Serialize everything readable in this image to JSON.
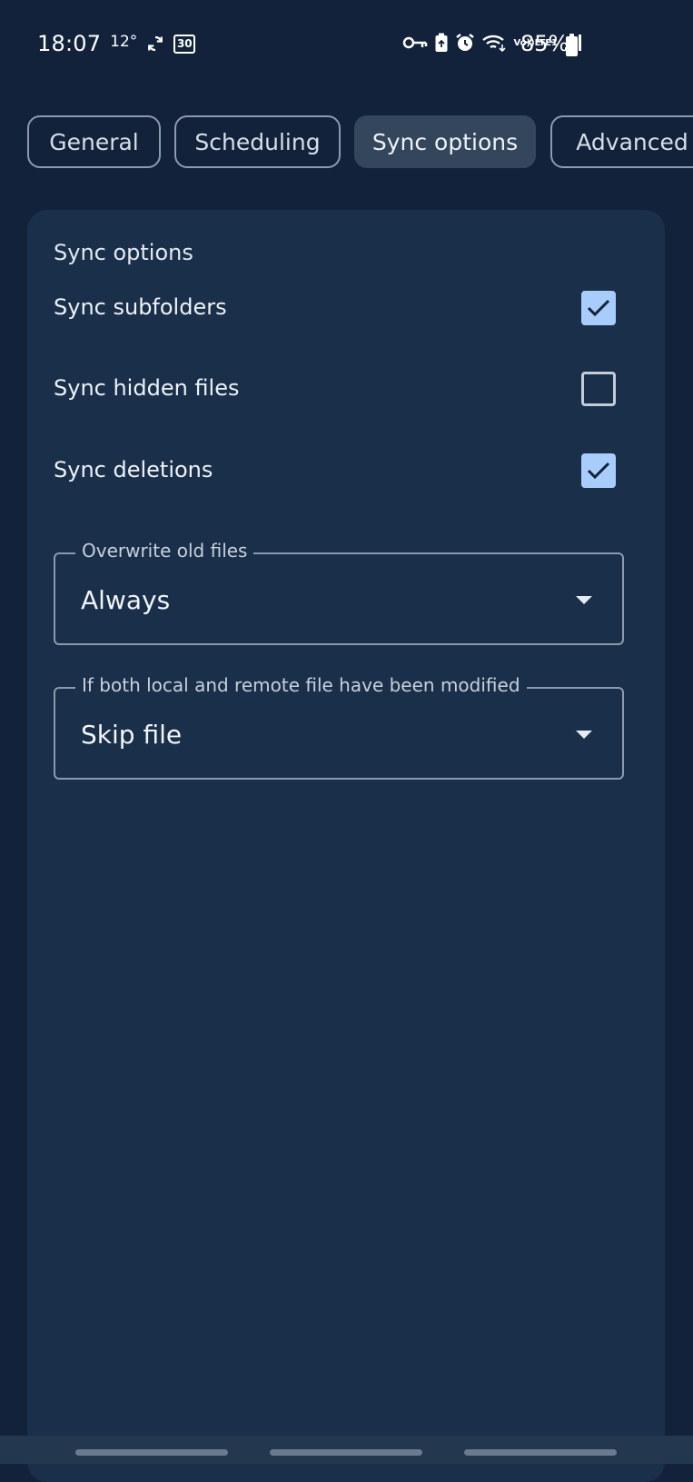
{
  "status_bar": {
    "time": "18:07",
    "temperature": "12°",
    "calendar_day": "30",
    "lte": "Vo))\nLTE1",
    "battery": "85%"
  },
  "tabs": [
    {
      "label": "General",
      "active": false
    },
    {
      "label": "Scheduling",
      "active": false
    },
    {
      "label": "Sync options",
      "active": true
    },
    {
      "label": "Advanced",
      "active": false
    }
  ],
  "section": {
    "title": "Sync options",
    "options": [
      {
        "label": "Sync subfolders",
        "checked": true
      },
      {
        "label": "Sync hidden files",
        "checked": false
      },
      {
        "label": "Sync deletions",
        "checked": true
      }
    ],
    "dropdowns": [
      {
        "label": "Overwrite old files",
        "value": "Always"
      },
      {
        "label": "If both local and remote file have been modified",
        "value": "Skip file"
      }
    ]
  },
  "colors": {
    "background": "#12223a",
    "card": "#1a2f4a",
    "active_tab": "#34465c",
    "checkbox_checked": "#a9cdfa"
  }
}
